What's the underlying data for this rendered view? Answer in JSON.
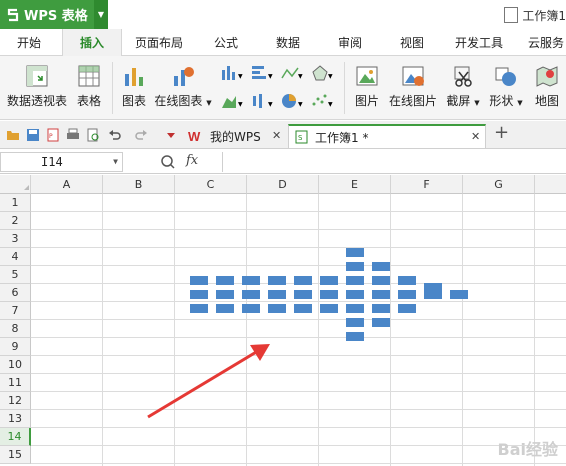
{
  "app": {
    "title": "WPS 表格",
    "document_title": "工作簿1"
  },
  "menu": {
    "tabs": [
      {
        "label": "开始"
      },
      {
        "label": "插入"
      },
      {
        "label": "页面布局"
      },
      {
        "label": "公式"
      },
      {
        "label": "数据"
      },
      {
        "label": "审阅"
      },
      {
        "label": "视图"
      },
      {
        "label": "开发工具"
      },
      {
        "label": "云服务"
      }
    ],
    "active": "插入"
  },
  "ribbon": {
    "pivot": "数据透视表",
    "table": "表格",
    "chart": "图表",
    "online_chart": "在线图表",
    "picture": "图片",
    "online_picture": "在线图片",
    "screenshot": "截屏",
    "shape": "形状",
    "map": "地图"
  },
  "tabs": {
    "mywps": "我的WPS",
    "workbook": "工作簿1 *"
  },
  "formula_bar": {
    "cell_ref": "I14",
    "fx": "fx",
    "value": ""
  },
  "columns": [
    "A",
    "B",
    "C",
    "D",
    "E",
    "F",
    "G"
  ],
  "rows": [
    "1",
    "2",
    "3",
    "4",
    "5",
    "6",
    "7",
    "8",
    "9",
    "10",
    "11",
    "12",
    "13",
    "14",
    "15"
  ],
  "selected_row": "14",
  "colors": {
    "brand": "#3f9c3f",
    "shape": "#4a86c8",
    "arrow": "#e53935"
  },
  "watermark": "Bai经验"
}
